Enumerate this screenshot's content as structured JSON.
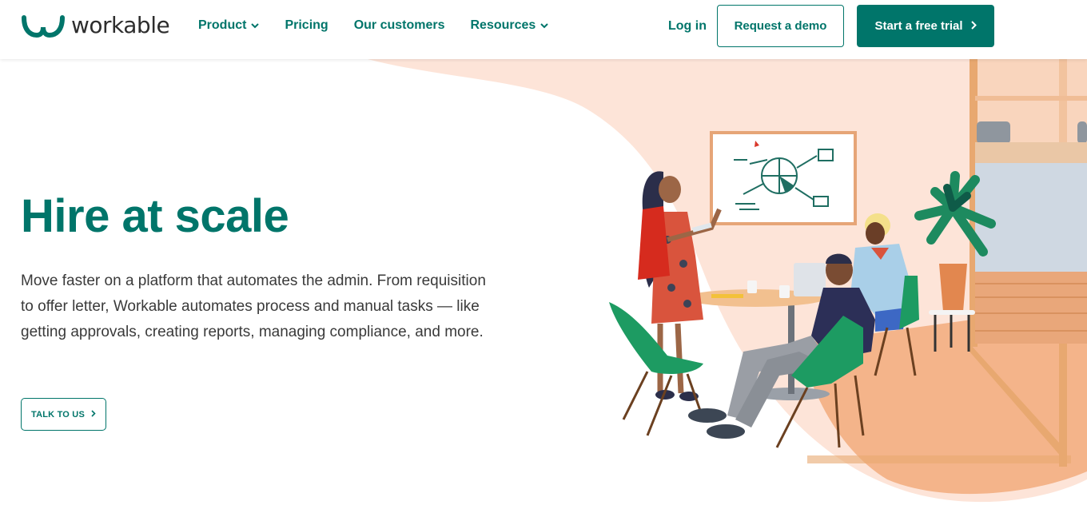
{
  "brand": {
    "name": "workable",
    "color": "#00756a"
  },
  "nav": {
    "items": [
      {
        "label": "Product",
        "has_dropdown": true
      },
      {
        "label": "Pricing",
        "has_dropdown": false
      },
      {
        "label": "Our customers",
        "has_dropdown": false
      },
      {
        "label": "Resources",
        "has_dropdown": true
      }
    ],
    "login": "Log in",
    "demo_button": "Request a demo",
    "trial_button": "Start a free trial"
  },
  "hero": {
    "title": "Hire at scale",
    "description": "Move faster on a platform that automates the admin. From requisition to offer letter, Workable automates process and manual tasks — like getting approvals, creating reports, managing compliance, and more.",
    "cta": "TALK TO US"
  },
  "icons": [
    "workable-logo-icon",
    "chevron-down-icon",
    "chevron-right-icon"
  ]
}
